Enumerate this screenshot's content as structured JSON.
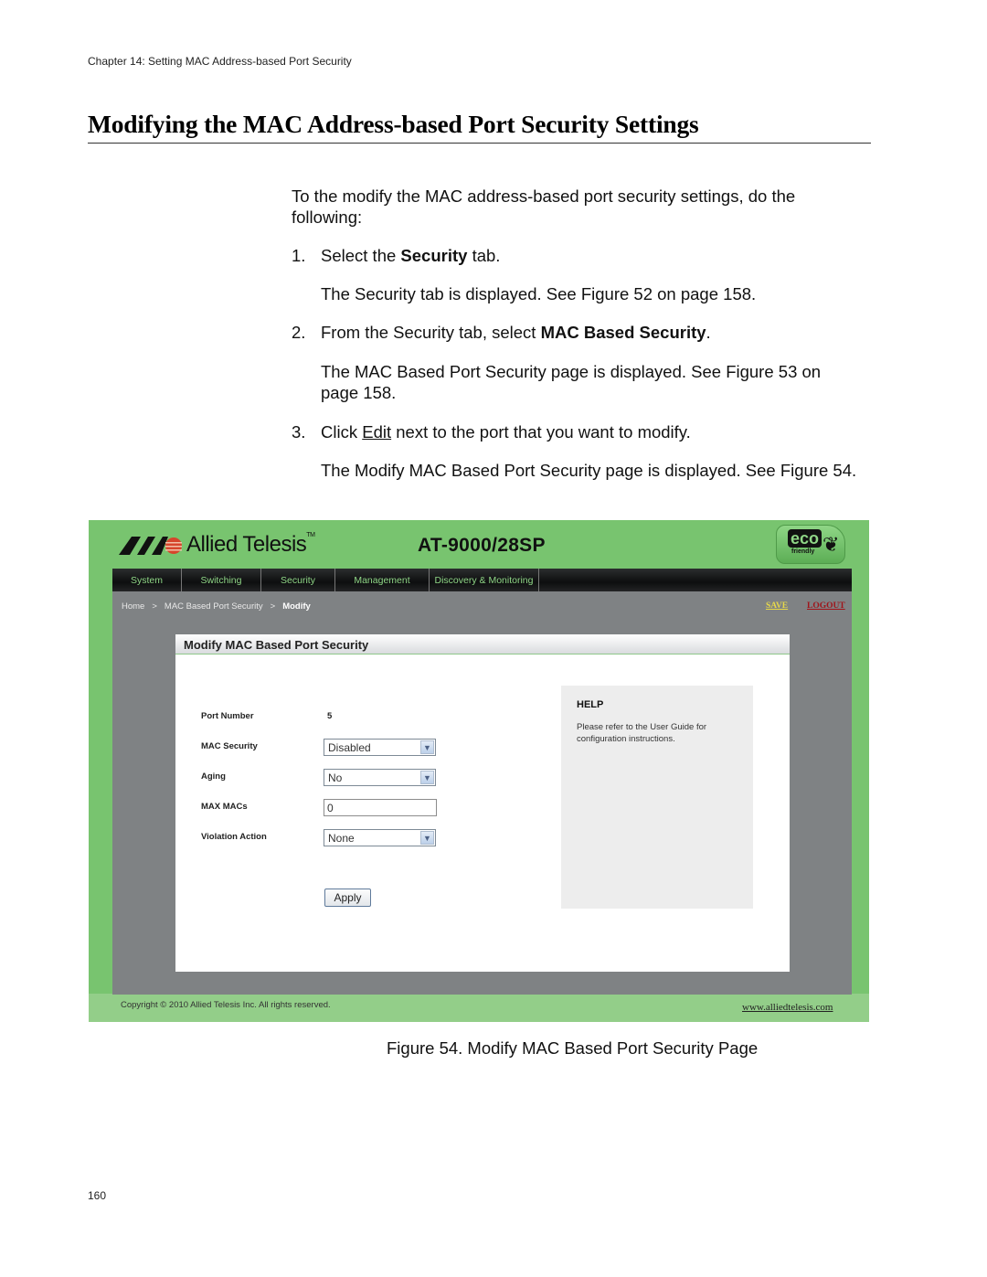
{
  "running_head": "Chapter 14: Setting MAC Address-based Port Security",
  "title": "Modifying the MAC Address-based Port Security Settings",
  "intro": "To the modify the MAC address-based port security settings, do the following:",
  "steps": [
    {
      "num": "1.",
      "pre": "Select the ",
      "bold": "Security",
      "post": " tab.",
      "result": "The Security tab is displayed. See Figure 52 on page 158."
    },
    {
      "num": "2.",
      "pre": "From the Security tab, select ",
      "bold": "MAC Based Security",
      "post": ".",
      "result": "The MAC Based Port Security page is displayed. See Figure 53 on page 158."
    },
    {
      "num": "3.",
      "pre": "Click ",
      "link": "Edit",
      "post": " next to the port that you want to modify.",
      "result": "The Modify MAC Based Port Security page is displayed. See Figure 54."
    }
  ],
  "figure": {
    "brand": "Allied Telesis",
    "brand_tm": "TM",
    "model": "AT-9000/28SP",
    "eco_badge": {
      "word": "eco",
      "sub": "friendly"
    },
    "nav_tabs": [
      "System",
      "Switching",
      "Security",
      "Management",
      "Discovery & Monitoring"
    ],
    "breadcrumb": {
      "home": "Home",
      "sep": ">",
      "section": "MAC Based Port Security",
      "current": "Modify"
    },
    "save_label": "SAVE",
    "logout_label": "LOGOUT",
    "panel_title": "Modify MAC Based Port Security",
    "fields": {
      "port_number": {
        "label": "Port Number",
        "value": "5"
      },
      "mac_security": {
        "label": "MAC Security",
        "value": "Disabled"
      },
      "aging": {
        "label": "Aging",
        "value": "No"
      },
      "max_macs": {
        "label": "MAX MACs",
        "value": "0"
      },
      "violation_action": {
        "label": "Violation Action",
        "value": "None"
      }
    },
    "apply_label": "Apply",
    "help": {
      "title": "HELP",
      "text": "Please refer to the User Guide for configuration instructions."
    },
    "copyright": "Copyright © 2010 Allied Telesis Inc. All rights reserved.",
    "site_link": "www.alliedtelesis.com",
    "colors": {
      "brand_green": "#78c46f",
      "nav_text": "#8fd686",
      "save": "#e6d84a",
      "logout": "#a0141a",
      "console_gray": "#7f8284"
    }
  },
  "caption": "Figure 54. Modify MAC Based Port Security Page",
  "page_number": "160"
}
